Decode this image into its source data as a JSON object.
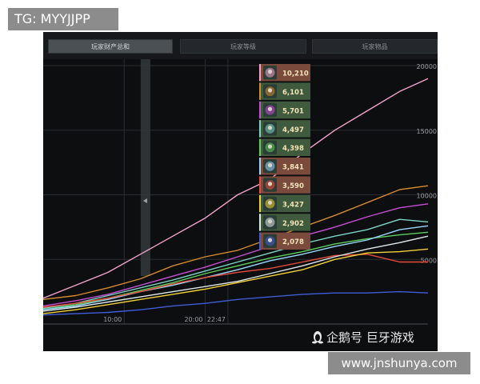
{
  "overlay": {
    "tg_label": "TG: MYYJJPP",
    "site_label": "www.jnshunya.com"
  },
  "tabs": [
    {
      "label": "玩家财产总和",
      "active": true
    },
    {
      "label": "玩家等级",
      "active": false
    },
    {
      "label": "玩家物品",
      "active": false
    }
  ],
  "watermark": {
    "text": "企鹅号 巨牙游戏"
  },
  "colors": {
    "bg": "#0d0e10",
    "grid": "#2a2d31",
    "tick_text": "#9aa0a6",
    "scrubber": "#34383c"
  },
  "chart_data": {
    "type": "line",
    "title": "",
    "xlabel": "",
    "ylabel": "",
    "x_ticks": [
      "10:00",
      "20:00",
      "22:47"
    ],
    "x_range_minutes": [
      0,
      47.5
    ],
    "x_tick_minutes": [
      10,
      20,
      22.8
    ],
    "y_ticks": [
      5000,
      10000,
      15000,
      20000
    ],
    "y_tick_labels": [
      "5000",
      "10000",
      "15000",
      "20000"
    ],
    "ylim": [
      0,
      20000
    ],
    "grid": true,
    "scrubber_minute": 7.1,
    "x": [
      0,
      4,
      8,
      12,
      16,
      20,
      24,
      28,
      32,
      36,
      40,
      44,
      47.5
    ],
    "series": [
      {
        "color": "#f5a3cf",
        "values": [
          2000,
          3000,
          4000,
          5400,
          6800,
          8200,
          10000,
          11200,
          13200,
          15000,
          16500,
          18000,
          19000
        ]
      },
      {
        "color": "#d68a2c",
        "values": [
          1900,
          2200,
          2800,
          3500,
          4500,
          5200,
          5700,
          6600,
          7500,
          8400,
          9400,
          10400,
          10700
        ]
      },
      {
        "color": "#c84ed6",
        "values": [
          1400,
          1800,
          2300,
          3000,
          3700,
          4400,
          5200,
          6000,
          6800,
          7500,
          8300,
          9000,
          9300
        ]
      },
      {
        "color": "#7ed4c4",
        "values": [
          1200,
          1600,
          2200,
          2800,
          3400,
          4100,
          4800,
          5500,
          6200,
          6800,
          7300,
          8100,
          7900
        ]
      },
      {
        "color": "#5ccf5c",
        "values": [
          1100,
          1500,
          2000,
          2600,
          3200,
          3900,
          4500,
          5100,
          5600,
          6200,
          6600,
          6900,
          7100
        ]
      },
      {
        "color": "#9ad9ff",
        "values": [
          1100,
          1400,
          1900,
          2500,
          3000,
          3600,
          4200,
          4900,
          5400,
          6000,
          6500,
          7300,
          7600
        ]
      },
      {
        "color": "#e84c3a",
        "values": [
          1300,
          1600,
          2000,
          2500,
          3100,
          3600,
          4000,
          4300,
          4800,
          5300,
          5400,
          4800,
          4800
        ]
      },
      {
        "color": "#f3d234",
        "values": [
          800,
          1100,
          1500,
          1900,
          2300,
          2700,
          3200,
          3700,
          4200,
          5000,
          5500,
          5600,
          5800
        ]
      },
      {
        "color": "#dfe9ea",
        "values": [
          1000,
          1300,
          1700,
          2100,
          2500,
          2900,
          3300,
          3900,
          4500,
          5200,
          5800,
          6300,
          6800
        ]
      },
      {
        "color": "#3f5ed8",
        "values": [
          700,
          800,
          900,
          1100,
          1400,
          1600,
          1900,
          2100,
          2300,
          2400,
          2400,
          2500,
          2400
        ]
      }
    ],
    "leaderboard": [
      {
        "icon": "hero-portrait-icon",
        "value": "10,210",
        "row_color": "#7a4b3d",
        "bar_color": "#f5a3cf"
      },
      {
        "icon": "hero-portrait-icon",
        "value": "6,101",
        "row_color": "#3f5a3c",
        "bar_color": "#d68a2c"
      },
      {
        "icon": "hero-portrait-icon",
        "value": "5,701",
        "row_color": "#3f5a3c",
        "bar_color": "#c84ed6"
      },
      {
        "icon": "hero-portrait-icon",
        "value": "4,497",
        "row_color": "#3f5a3c",
        "bar_color": "#7ed4c4"
      },
      {
        "icon": "hero-portrait-icon",
        "value": "4,398",
        "row_color": "#3f5a3c",
        "bar_color": "#5ccf5c"
      },
      {
        "icon": "hero-portrait-icon",
        "value": "3,841",
        "row_color": "#7a4b3d",
        "bar_color": "#9ad9ff"
      },
      {
        "icon": "hero-portrait-icon",
        "value": "3,590",
        "row_color": "#7a4b3d",
        "bar_color": "#e84c3a"
      },
      {
        "icon": "hero-portrait-icon",
        "value": "3,427",
        "row_color": "#3f5a3c",
        "bar_color": "#f3d234"
      },
      {
        "icon": "hero-portrait-icon",
        "value": "2,902",
        "row_color": "#3f5a3c",
        "bar_color": "#dfe9ea"
      },
      {
        "icon": "hero-portrait-icon",
        "value": "2,078",
        "row_color": "#7a4b3d",
        "bar_color": "#3f5ed8"
      }
    ]
  }
}
